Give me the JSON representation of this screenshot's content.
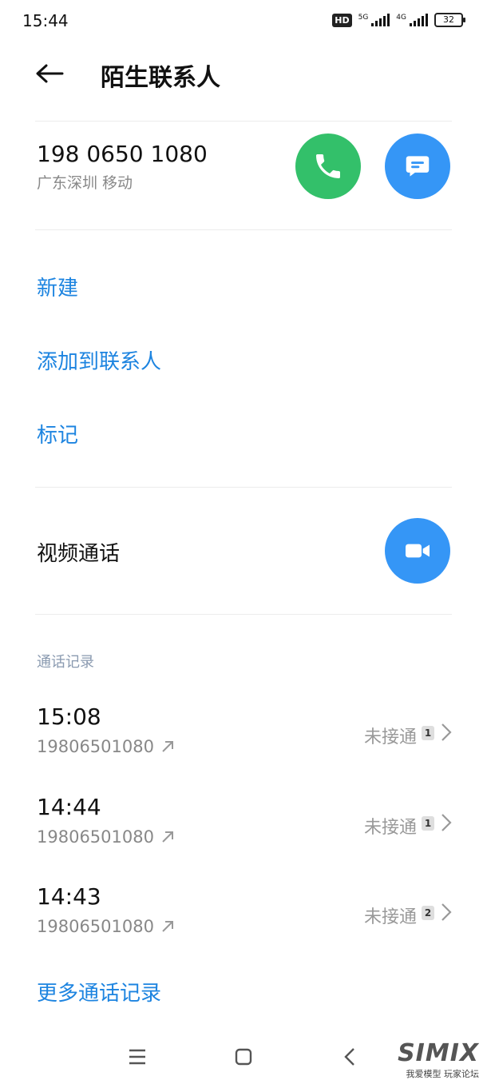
{
  "status": {
    "time": "15:44",
    "hd": "HD",
    "net1": "5G",
    "net2": "4G",
    "battery": "32"
  },
  "header": {
    "title": "陌生联系人"
  },
  "contact": {
    "number": "198 0650 1080",
    "location": "广东深圳 移动"
  },
  "actions": {
    "new": "新建",
    "add_to_contacts": "添加到联系人",
    "mark": "标记"
  },
  "video": {
    "label": "视频通话"
  },
  "history": {
    "section_label": "通话记录",
    "records": [
      {
        "time": "15:08",
        "number": "19806501080",
        "status": "未接通",
        "count": "1"
      },
      {
        "time": "14:44",
        "number": "19806501080",
        "status": "未接通",
        "count": "1"
      },
      {
        "time": "14:43",
        "number": "19806501080",
        "status": "未接通",
        "count": "2"
      }
    ],
    "more": "更多通话记录"
  },
  "watermark": {
    "logo": "SIMIX",
    "sub": "我爱模型 玩家论坛"
  },
  "colors": {
    "accent_blue": "#1d84e0",
    "call_green": "#33c06a",
    "button_blue": "#3596f6"
  }
}
